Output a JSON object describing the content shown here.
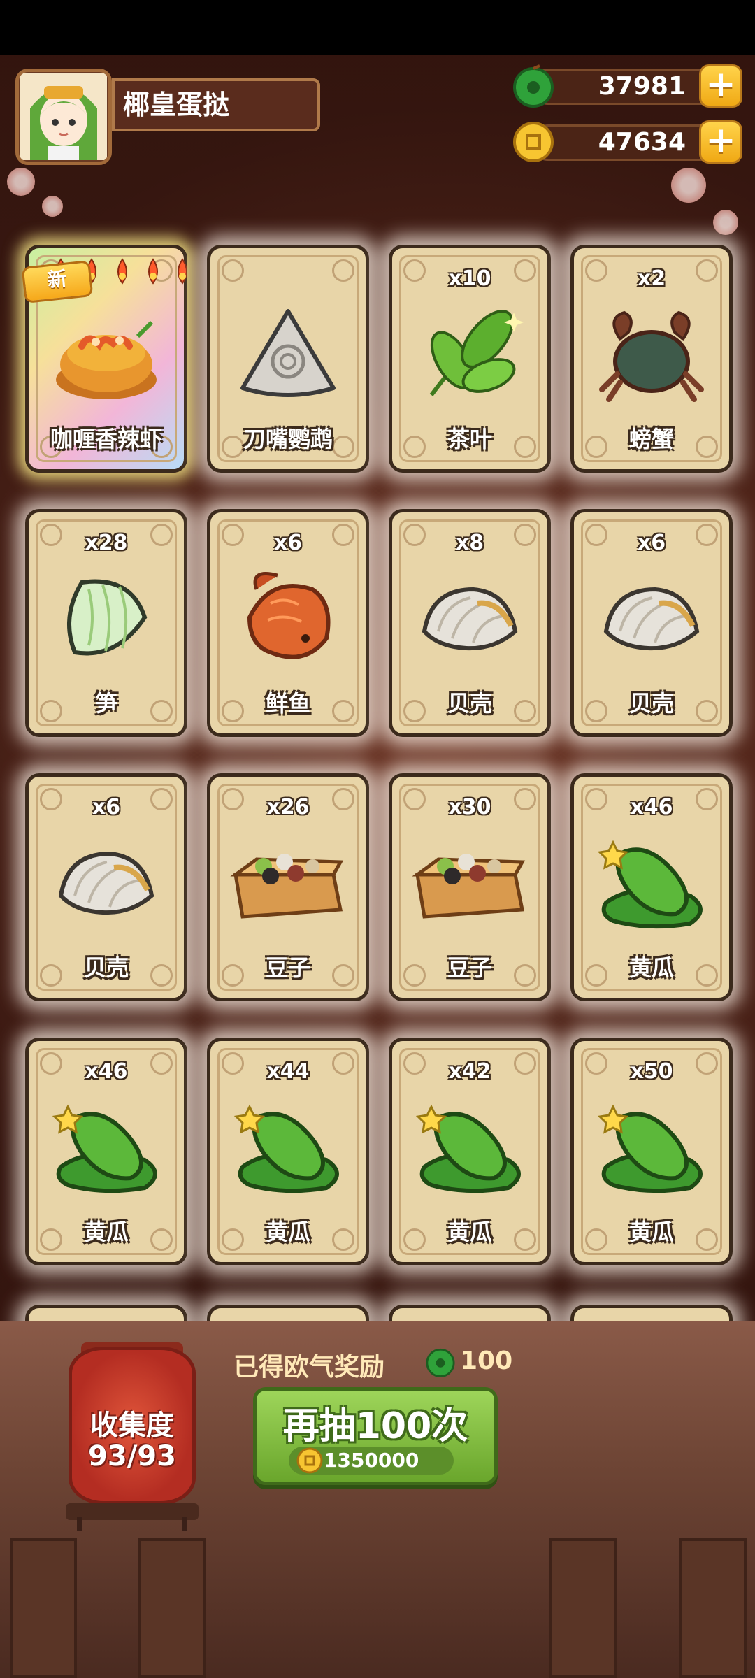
{
  "player": {
    "name": "椰皇蛋挞"
  },
  "currency": [
    {
      "type": "jade-gem",
      "amount": "37981",
      "add_label": "+"
    },
    {
      "type": "gold-coin",
      "amount": "47634",
      "add_label": "+"
    }
  ],
  "cards": [
    {
      "label": "咖喱香辣虾",
      "count": "",
      "art": "curry-shrimp",
      "new_badge": "新",
      "special": true
    },
    {
      "label": "刀嘴鹦鹉",
      "count": "",
      "art": "stone-parrot"
    },
    {
      "label": "茶叶",
      "count": "x10",
      "art": "tea-leaf"
    },
    {
      "label": "螃蟹",
      "count": "x2",
      "art": "crab"
    },
    {
      "label": "笋",
      "count": "x28",
      "art": "bamboo-shoot"
    },
    {
      "label": "鲜鱼",
      "count": "x6",
      "art": "fish"
    },
    {
      "label": "贝壳",
      "count": "x8",
      "art": "clam"
    },
    {
      "label": "贝壳",
      "count": "x6",
      "art": "clam"
    },
    {
      "label": "贝壳",
      "count": "x6",
      "art": "clam"
    },
    {
      "label": "豆子",
      "count": "x26",
      "art": "beans-box"
    },
    {
      "label": "豆子",
      "count": "x30",
      "art": "beans-box"
    },
    {
      "label": "黄瓜",
      "count": "x46",
      "art": "cucumber"
    },
    {
      "label": "黄瓜",
      "count": "x46",
      "art": "cucumber"
    },
    {
      "label": "黄瓜",
      "count": "x44",
      "art": "cucumber"
    },
    {
      "label": "黄瓜",
      "count": "x42",
      "art": "cucumber"
    },
    {
      "label": "黄瓜",
      "count": "x50",
      "art": "cucumber"
    }
  ],
  "collection": {
    "title": "收集度",
    "value": "93/93"
  },
  "reward": {
    "text": "已得欧气奖励",
    "amount": "100"
  },
  "draw": {
    "label": "再抽100次",
    "cost": "1350000"
  },
  "colors": {
    "accent_green": "#6aa62c",
    "card_bg": "#e8d5a8",
    "gold": "#f0a915"
  }
}
